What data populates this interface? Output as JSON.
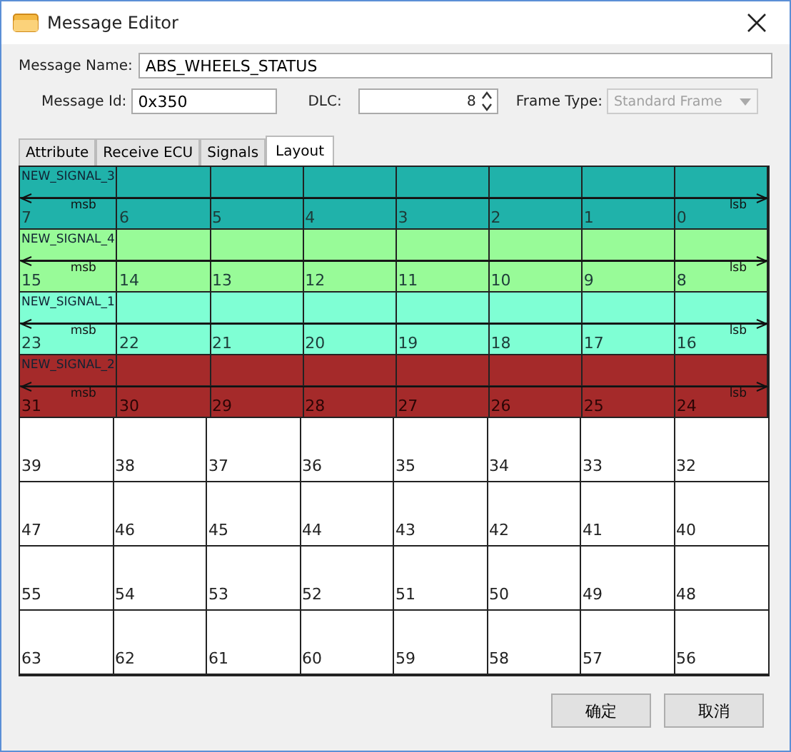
{
  "window": {
    "title": "Message Editor"
  },
  "message_name": {
    "label": "Message Name:",
    "value": "ABS_WHEELS_STATUS"
  },
  "message_id": {
    "label": "Message Id:",
    "value": "0x350"
  },
  "dlc": {
    "label": "DLC:",
    "value": "8"
  },
  "frame_type": {
    "label": "Frame Type:",
    "value": "Standard Frame",
    "disabled": true
  },
  "tabs": [
    {
      "label": "Attribute",
      "selected": false
    },
    {
      "label": "Receive ECU",
      "selected": false
    },
    {
      "label": "Signals",
      "selected": false
    },
    {
      "label": "Layout",
      "selected": true
    }
  ],
  "layout": {
    "rows": [
      {
        "signal": {
          "name": "NEW_SIGNAL_3",
          "color": "#20b2aa",
          "msb": "msb",
          "lsb": "lsb"
        },
        "bits": [
          "7",
          "6",
          "5",
          "4",
          "3",
          "2",
          "1",
          "0"
        ]
      },
      {
        "signal": {
          "name": "NEW_SIGNAL_4",
          "color": "#98fb98",
          "msb": "msb",
          "lsb": "lsb"
        },
        "bits": [
          "15",
          "14",
          "13",
          "12",
          "11",
          "10",
          "9",
          "8"
        ]
      },
      {
        "signal": {
          "name": "NEW_SIGNAL_1",
          "color": "#7fffd4",
          "msb": "msb",
          "lsb": "lsb"
        },
        "bits": [
          "23",
          "22",
          "21",
          "20",
          "19",
          "18",
          "17",
          "16"
        ]
      },
      {
        "signal": {
          "name": "NEW_SIGNAL_2",
          "color": "#a52a2a",
          "msb": "msb",
          "lsb": "lsb"
        },
        "bits": [
          "31",
          "30",
          "29",
          "28",
          "27",
          "26",
          "25",
          "24"
        ]
      },
      {
        "bits": [
          "39",
          "38",
          "37",
          "36",
          "35",
          "34",
          "33",
          "32"
        ]
      },
      {
        "bits": [
          "47",
          "46",
          "45",
          "44",
          "43",
          "42",
          "41",
          "40"
        ]
      },
      {
        "bits": [
          "55",
          "54",
          "53",
          "52",
          "51",
          "50",
          "49",
          "48"
        ]
      },
      {
        "bits": [
          "63",
          "62",
          "61",
          "60",
          "59",
          "58",
          "57",
          "56"
        ]
      }
    ]
  },
  "buttons": [
    "确定",
    "取消"
  ]
}
